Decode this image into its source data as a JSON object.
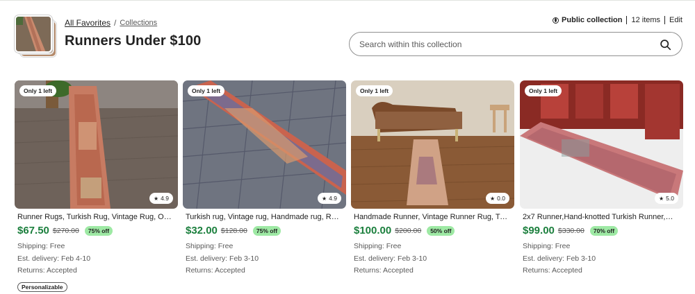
{
  "breadcrumb": {
    "home": "All Favorites",
    "separator": "/",
    "current": "Collections"
  },
  "collection": {
    "title": "Runners Under $100",
    "visibility": "Public collection",
    "item_count": "12 items",
    "edit_label": "Edit"
  },
  "search": {
    "placeholder": "Search within this collection",
    "icon": "search-icon"
  },
  "colors": {
    "price_green": "#1b7f3d",
    "discount_badge": "#9ee9a4",
    "text_dark": "#222222",
    "text_muted": "#595959"
  },
  "listings": [
    {
      "badge": "Only 1 left",
      "rating": "4.9",
      "title": "Runner Rugs, Turkish Rug, Vintage Rug, Ousha...",
      "price": "$67.50",
      "original_price": "$270.00",
      "discount": "75% off",
      "shipping_label": "Shipping:",
      "shipping": "Free",
      "delivery_label": "Est. delivery:",
      "delivery": "Feb 4-10",
      "returns_label": "Returns:",
      "returns": "Accepted",
      "tag": "Personalizable"
    },
    {
      "badge": "Only 1 left",
      "rating": "4.9",
      "title": "Turkish rug, Vintage rug, Handmade rug, Runn...",
      "price": "$32.00",
      "original_price": "$128.00",
      "discount": "75% off",
      "shipping_label": "Shipping:",
      "shipping": "Free",
      "delivery_label": "Est. delivery:",
      "delivery": "Feb 3-10",
      "returns_label": "Returns:",
      "returns": "Accepted"
    },
    {
      "badge": "Only 1 left",
      "rating": "0.0",
      "title": "Handmade Runner, Vintage Runner Rug, Turkis...",
      "price": "$100.00",
      "original_price": "$200.00",
      "discount": "50% off",
      "shipping_label": "Shipping:",
      "shipping": "Free",
      "delivery_label": "Est. delivery:",
      "delivery": "Feb 3-10",
      "returns_label": "Returns:",
      "returns": "Accepted"
    },
    {
      "badge": "Only 1 left",
      "rating": "5.0",
      "title": "2x7 Runner,Hand-knotted Turkish Runner,Oush...",
      "price": "$99.00",
      "original_price": "$330.00",
      "discount": "70% off",
      "shipping_label": "Shipping:",
      "shipping": "Free",
      "delivery_label": "Est. delivery:",
      "delivery": "Feb 3-10",
      "returns_label": "Returns:",
      "returns": "Accepted"
    }
  ]
}
